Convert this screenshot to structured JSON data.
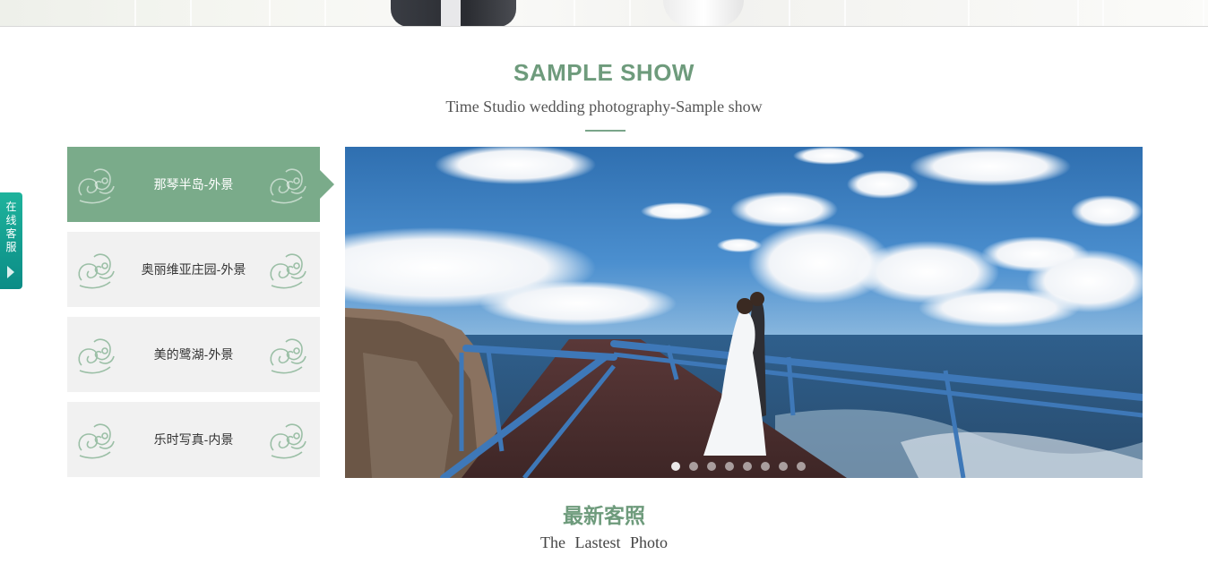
{
  "sample_section": {
    "title": "SAMPLE SHOW",
    "subtitle": "Time Studio wedding photography-Sample show"
  },
  "tabs": [
    {
      "label": "那琴半岛-外景",
      "active": true
    },
    {
      "label": "奥丽维亚庄园-外景",
      "active": false
    },
    {
      "label": "美的鹭湖-外景",
      "active": false
    },
    {
      "label": "乐时写真-内景",
      "active": false
    }
  ],
  "slider": {
    "slide_count": 8,
    "active_index": 0
  },
  "service_tab": {
    "label": "在线客服"
  },
  "latest_section": {
    "title": "最新客照",
    "subtitle": "The Lastest Photo"
  },
  "colors": {
    "accent": "#7aab8a",
    "title_green": "#6e9b7c",
    "service_teal": "#13a294"
  }
}
